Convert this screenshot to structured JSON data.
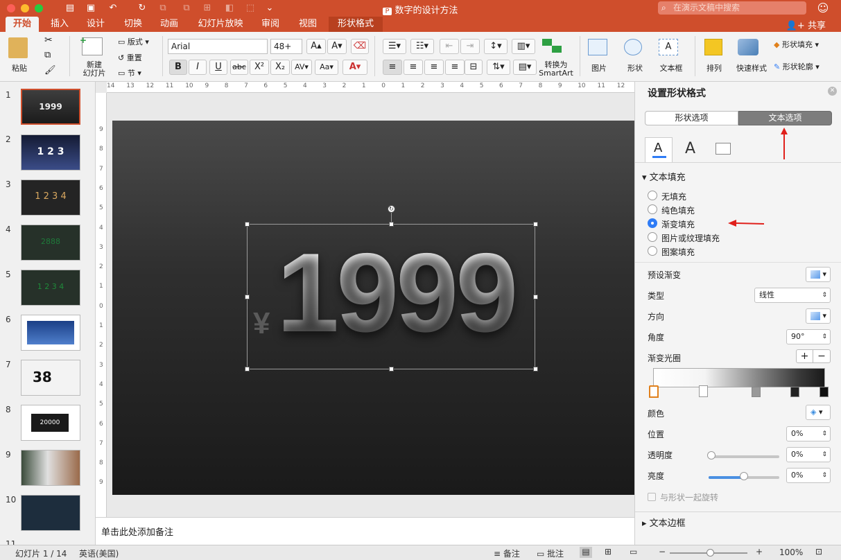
{
  "window": {
    "title": "数字的设计方法"
  },
  "search": {
    "placeholder": "在演示文稿中搜索"
  },
  "tabs": [
    "开始",
    "插入",
    "设计",
    "切换",
    "动画",
    "幻灯片放映",
    "审阅",
    "视图",
    "形状格式"
  ],
  "share_label": "共享",
  "ribbon": {
    "paste": "粘贴",
    "new_slide_1": "新建",
    "new_slide_2": "幻灯片",
    "layout": "版式",
    "reset": "重置",
    "section": "节",
    "font_name": "Arial",
    "font_size": "48+",
    "picture": "图片",
    "shape": "形状",
    "textbox": "文本框",
    "arrange": "排列",
    "quick_styles": "快速样式",
    "shape_fill": "形状填充",
    "shape_outline": "形状轮廓",
    "convert_1": "转换为",
    "convert_2": "SmartArt"
  },
  "ruler": {
    "h": [
      "14",
      "13",
      "12",
      "11",
      "10",
      "9",
      "8",
      "7",
      "6",
      "5",
      "4",
      "3",
      "2",
      "1",
      "0",
      "1",
      "2",
      "3",
      "4",
      "5",
      "6",
      "7",
      "8",
      "9",
      "10",
      "11",
      "12"
    ],
    "v": [
      "9",
      "8",
      "7",
      "6",
      "5",
      "4",
      "3",
      "2",
      "1",
      "0",
      "1",
      "2",
      "3",
      "4",
      "5",
      "6",
      "7",
      "8",
      "9"
    ]
  },
  "slides": [
    {
      "num": "1",
      "text": "1999"
    },
    {
      "num": "2",
      "text": "1  2  3"
    },
    {
      "num": "3",
      "text": "1 2 3 4"
    },
    {
      "num": "4",
      "text": "2888"
    },
    {
      "num": "5",
      "text": "1 2 3 4"
    },
    {
      "num": "6",
      "text": ""
    },
    {
      "num": "7",
      "text": "38"
    },
    {
      "num": "8",
      "text": "20000"
    },
    {
      "num": "9",
      "text": ""
    },
    {
      "num": "10",
      "text": ""
    },
    {
      "num": "11",
      "text": ""
    }
  ],
  "slide_content": {
    "currency": "¥",
    "number": "1999"
  },
  "notes_placeholder": "单击此处添加备注",
  "pane": {
    "title": "设置形状格式",
    "tab_shape": "形状选项",
    "tab_text": "文本选项",
    "section_fill": "文本填充",
    "opt_none": "无填充",
    "opt_solid": "纯色填充",
    "opt_gradient": "渐变填充",
    "opt_picture": "图片或纹理填充",
    "opt_pattern": "图案填充",
    "preset": "预设渐变",
    "type_label": "类型",
    "type_value": "线性",
    "direction": "方向",
    "angle_label": "角度",
    "angle_value": "90°",
    "stops_label": "渐变光圈",
    "color_label": "颜色",
    "position_label": "位置",
    "position_value": "0%",
    "transparency_label": "透明度",
    "transparency_value": "0%",
    "brightness_label": "亮度",
    "brightness_value": "0%",
    "rotate_with_shape": "与形状一起旋转",
    "section_textbox": "文本边框"
  },
  "status": {
    "slide_info": "幻灯片 1 / 14",
    "language": "英语(美国)",
    "notes": "备注",
    "comments": "批注",
    "zoom": "100%"
  },
  "colors": {
    "accent": "#cf4e2c",
    "selected": "#2f7cf6",
    "arrow": "#e0201b"
  }
}
